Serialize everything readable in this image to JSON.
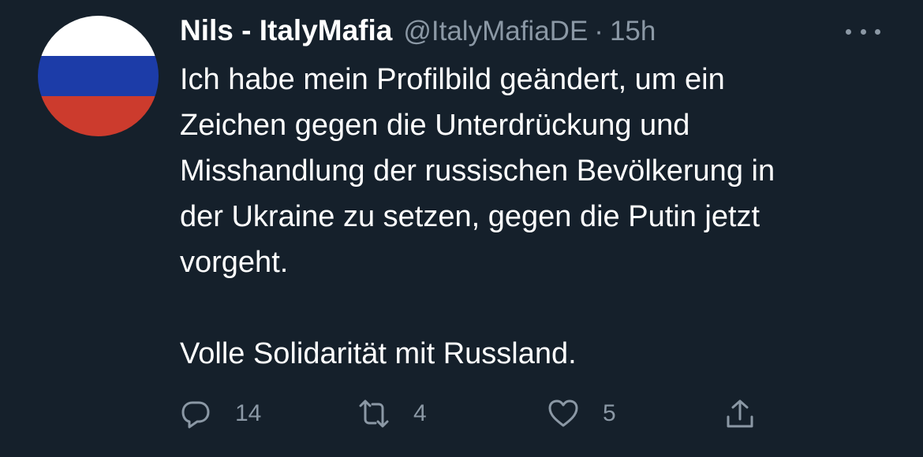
{
  "tweet": {
    "author": {
      "display_name": "Nils - ItalyMafia",
      "handle": "@ItalyMafiaDE",
      "separator": "·",
      "time": "15h",
      "avatar": {
        "type": "flag",
        "stripes": [
          "#ffffff",
          "#1c3ca8",
          "#cc3b2d"
        ]
      }
    },
    "more_icon": "more-horizontal-icon",
    "text_lines": [
      "Ich habe mein Profilbild geändert, um ein",
      "Zeichen gegen die Unterdrückung und",
      "Misshandlung der russischen Bevölkerung in",
      "der Ukraine zu setzen, gegen die Putin jetzt",
      "vorgeht."
    ],
    "closing_line": "Volle Solidarität mit Russland.",
    "actions": {
      "reply": {
        "icon": "reply-icon",
        "count": "14"
      },
      "retweet": {
        "icon": "retweet-icon",
        "count": "4"
      },
      "like": {
        "icon": "heart-icon",
        "count": "5"
      },
      "share": {
        "icon": "share-icon"
      }
    }
  },
  "colors": {
    "background": "#15202b",
    "primary_text": "#ffffff",
    "secondary_text": "#8b98a5"
  }
}
